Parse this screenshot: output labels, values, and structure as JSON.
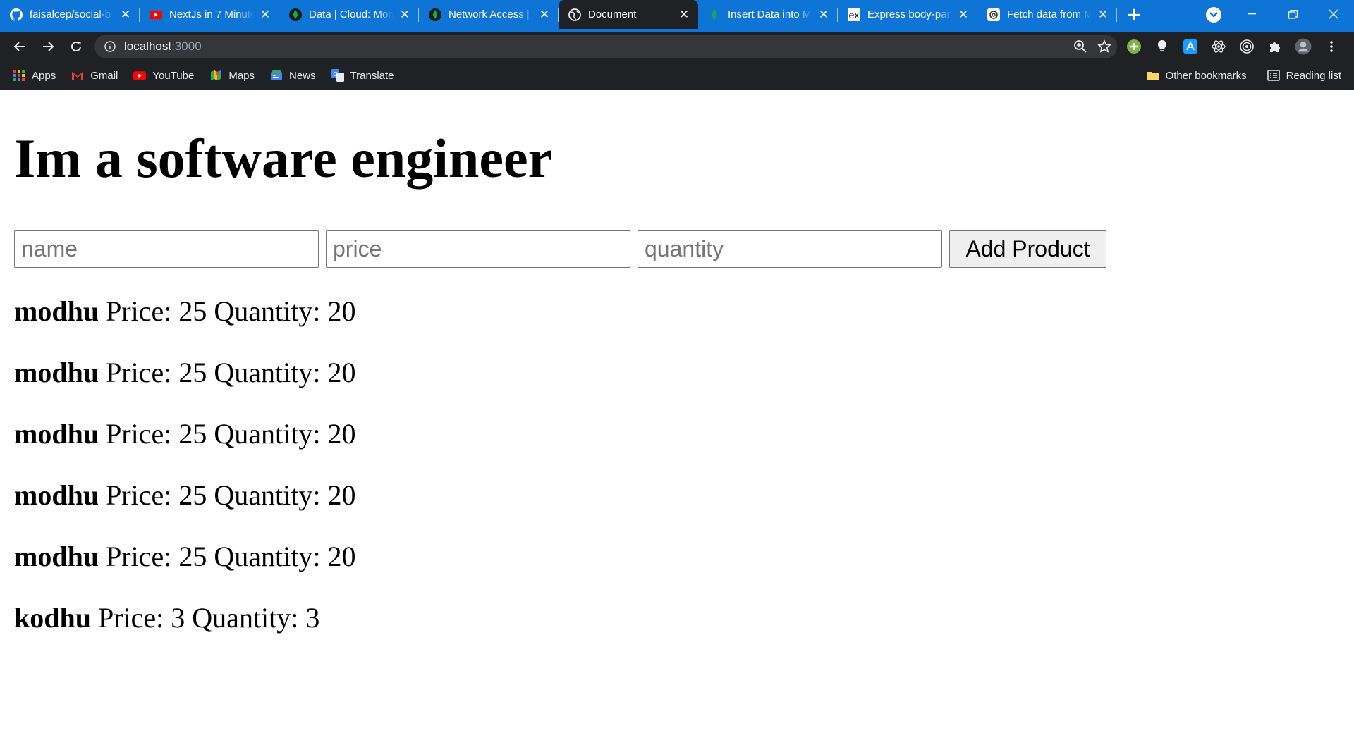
{
  "browser": {
    "tabs": [
      {
        "title": "faisalcep/social-b",
        "icon": "github-icon"
      },
      {
        "title": "NextJs in 7 Minute",
        "icon": "youtube-icon"
      },
      {
        "title": "Data | Cloud: Mon",
        "icon": "mongodb-leaf-icon"
      },
      {
        "title": "Network Access |",
        "icon": "mongodb-leaf-icon"
      },
      {
        "title": "Document",
        "icon": "globe-icon"
      },
      {
        "title": "Insert Data into M",
        "icon": "mongodb-leaf-icon"
      },
      {
        "title": "Express body-par",
        "icon": "express-icon"
      },
      {
        "title": "Fetch data from M",
        "icon": "openai-icon"
      }
    ],
    "express_icon_text": "ex",
    "address": {
      "host": "localhost",
      "port": ":3000"
    },
    "bookmarks": [
      {
        "label": "Apps",
        "icon": "apps-grid-icon"
      },
      {
        "label": "Gmail",
        "icon": "gmail-icon"
      },
      {
        "label": "YouTube",
        "icon": "youtube-icon"
      },
      {
        "label": "Maps",
        "icon": "maps-icon"
      },
      {
        "label": "News",
        "icon": "news-icon"
      },
      {
        "label": "Translate",
        "icon": "translate-icon"
      }
    ],
    "other_bookmarks": "Other bookmarks",
    "reading_list": "Reading list",
    "colors": {
      "tab_strip": "#0e75d6",
      "toolbar": "#202124",
      "omnibox": "#35363a"
    }
  },
  "page": {
    "heading": "Im a software engineer",
    "form": {
      "name_placeholder": "name",
      "price_placeholder": "price",
      "quantity_placeholder": "quantity",
      "name_value": "",
      "price_value": "",
      "quantity_value": "",
      "submit_label": "Add Product"
    },
    "price_label": "Price:",
    "quantity_label": "Quantity:",
    "products": [
      {
        "name": "modhu",
        "price": "25",
        "quantity": "20"
      },
      {
        "name": "modhu",
        "price": "25",
        "quantity": "20"
      },
      {
        "name": "modhu",
        "price": "25",
        "quantity": "20"
      },
      {
        "name": "modhu",
        "price": "25",
        "quantity": "20"
      },
      {
        "name": "modhu",
        "price": "25",
        "quantity": "20"
      },
      {
        "name": "kodhu",
        "price": "3",
        "quantity": "3"
      }
    ]
  }
}
